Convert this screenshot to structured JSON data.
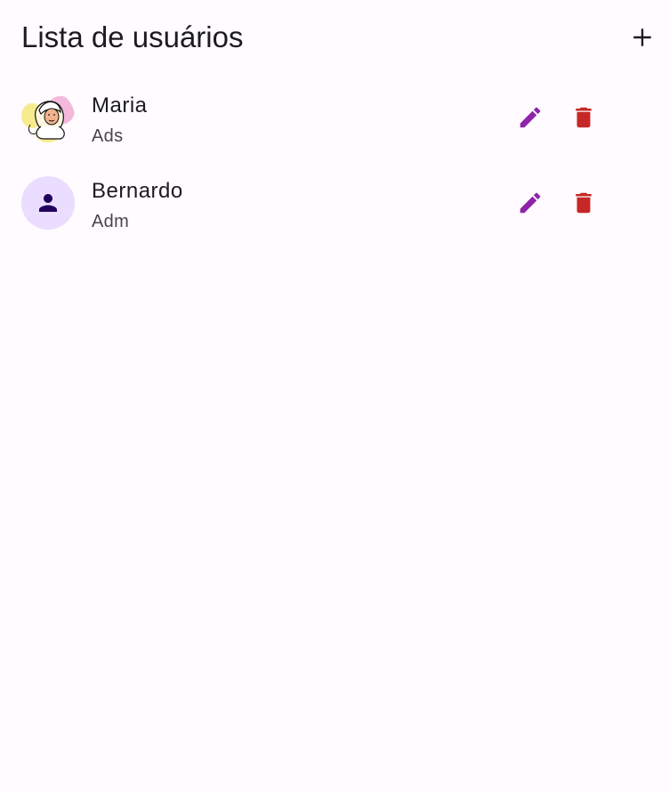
{
  "header": {
    "title": "Lista de usuários",
    "add_icon": "plus-icon"
  },
  "users": [
    {
      "name": "Maria",
      "role": "Ads",
      "avatar": "illustrated-portrait",
      "edit_icon": "pencil-icon",
      "delete_icon": "trash-icon"
    },
    {
      "name": "Bernardo",
      "role": "Adm",
      "avatar": "person-icon",
      "edit_icon": "pencil-icon",
      "delete_icon": "trash-icon"
    }
  ],
  "colors": {
    "background": "#fffbfe",
    "edit": "#8e24aa",
    "delete": "#c62828",
    "avatar_bg": "#eaddff",
    "avatar_icon": "#21005d",
    "text": "#1c1b1f",
    "subtext": "#49454f"
  }
}
